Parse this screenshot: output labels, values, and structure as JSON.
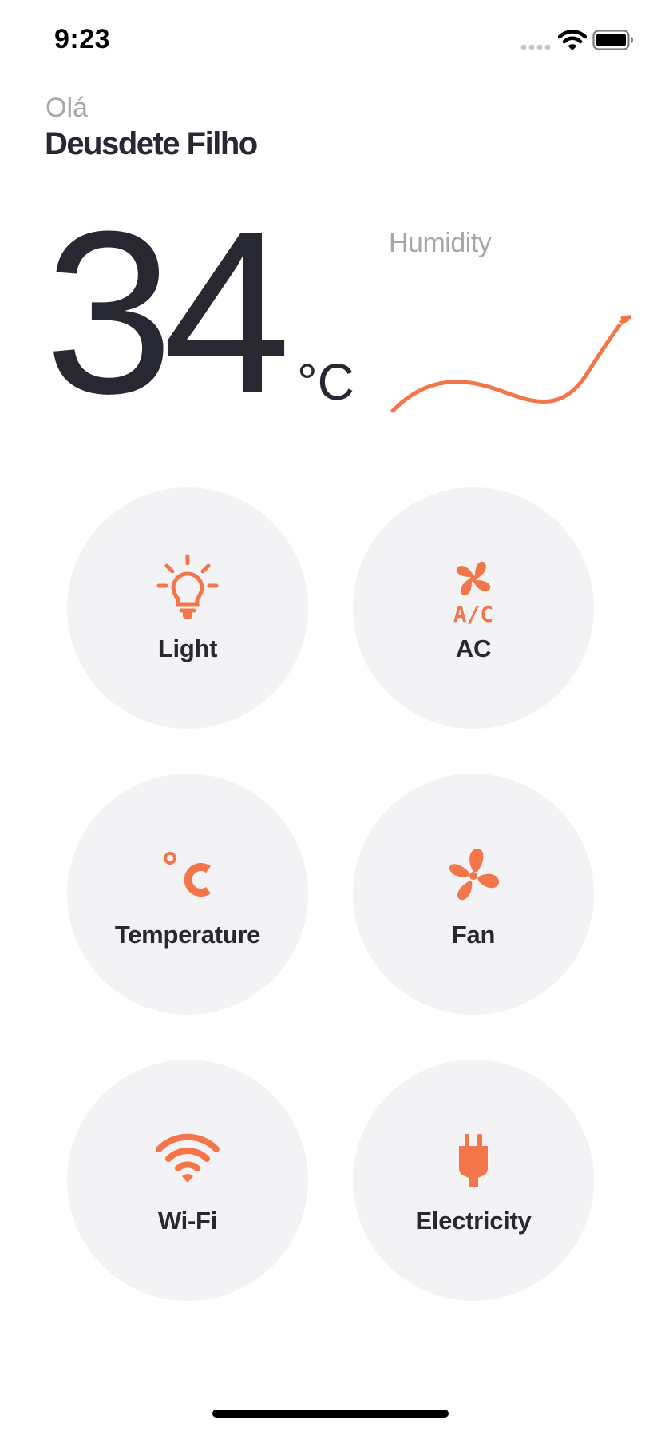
{
  "status_bar": {
    "time": "9:23"
  },
  "header": {
    "greeting": "Olá",
    "user_name": "Deusdete Filho"
  },
  "weather": {
    "temperature": "34",
    "unit": "°C",
    "humidity_label": "Humidity"
  },
  "devices": [
    {
      "label": "Light",
      "icon": "lightbulb-icon"
    },
    {
      "label": "AC",
      "icon": "air-conditioner-icon"
    },
    {
      "label": "Temperature",
      "icon": "celsius-icon"
    },
    {
      "label": "Fan",
      "icon": "fan-icon"
    },
    {
      "label": "Wi-Fi",
      "icon": "wifi-icon"
    },
    {
      "label": "Electricity",
      "icon": "plug-icon"
    }
  ],
  "colors": {
    "accent": "#f3764a",
    "text_primary": "#282833",
    "text_secondary": "#a7a7ab",
    "tile_background": "#f3f3f5"
  }
}
